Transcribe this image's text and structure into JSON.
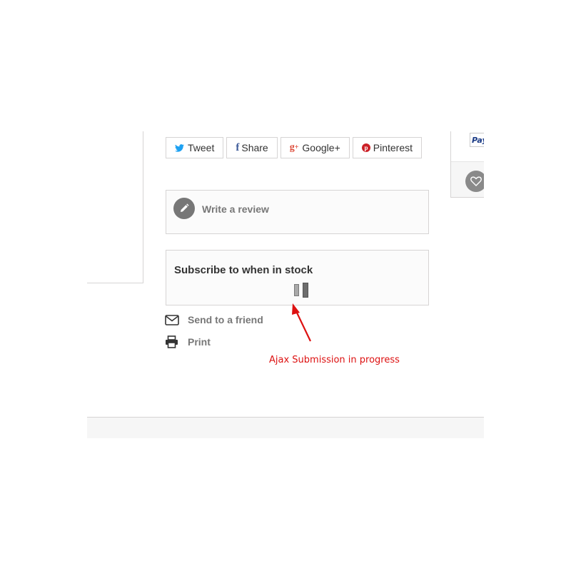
{
  "share": {
    "tweet_label": "Tweet",
    "share_label": "Share",
    "googleplus_label": "Google+",
    "pinterest_label": "Pinterest"
  },
  "review": {
    "label": "Write a review"
  },
  "subscribe": {
    "title": "Subscribe to when in stock"
  },
  "links": {
    "send_to_friend": "Send to a friend",
    "print": "Print"
  },
  "sidebar_right": {
    "payment_badge": "Pay"
  },
  "annotation": {
    "text": "Ajax Submission in progress"
  },
  "colors": {
    "twitter": "#1da1f2",
    "facebook": "#3b5998",
    "googleplus": "#dd4b39",
    "pinterest": "#cb2027",
    "annotation": "#dd1111",
    "border": "#d6d4d4"
  },
  "icons": {
    "tweet": "twitter-icon",
    "share": "facebook-icon",
    "googleplus": "google-plus-icon",
    "pinterest": "pinterest-icon",
    "review": "pencil-icon",
    "send": "envelope-icon",
    "print": "printer-icon",
    "wishlist": "heart-icon",
    "loading": "loading-spinner-icon"
  }
}
